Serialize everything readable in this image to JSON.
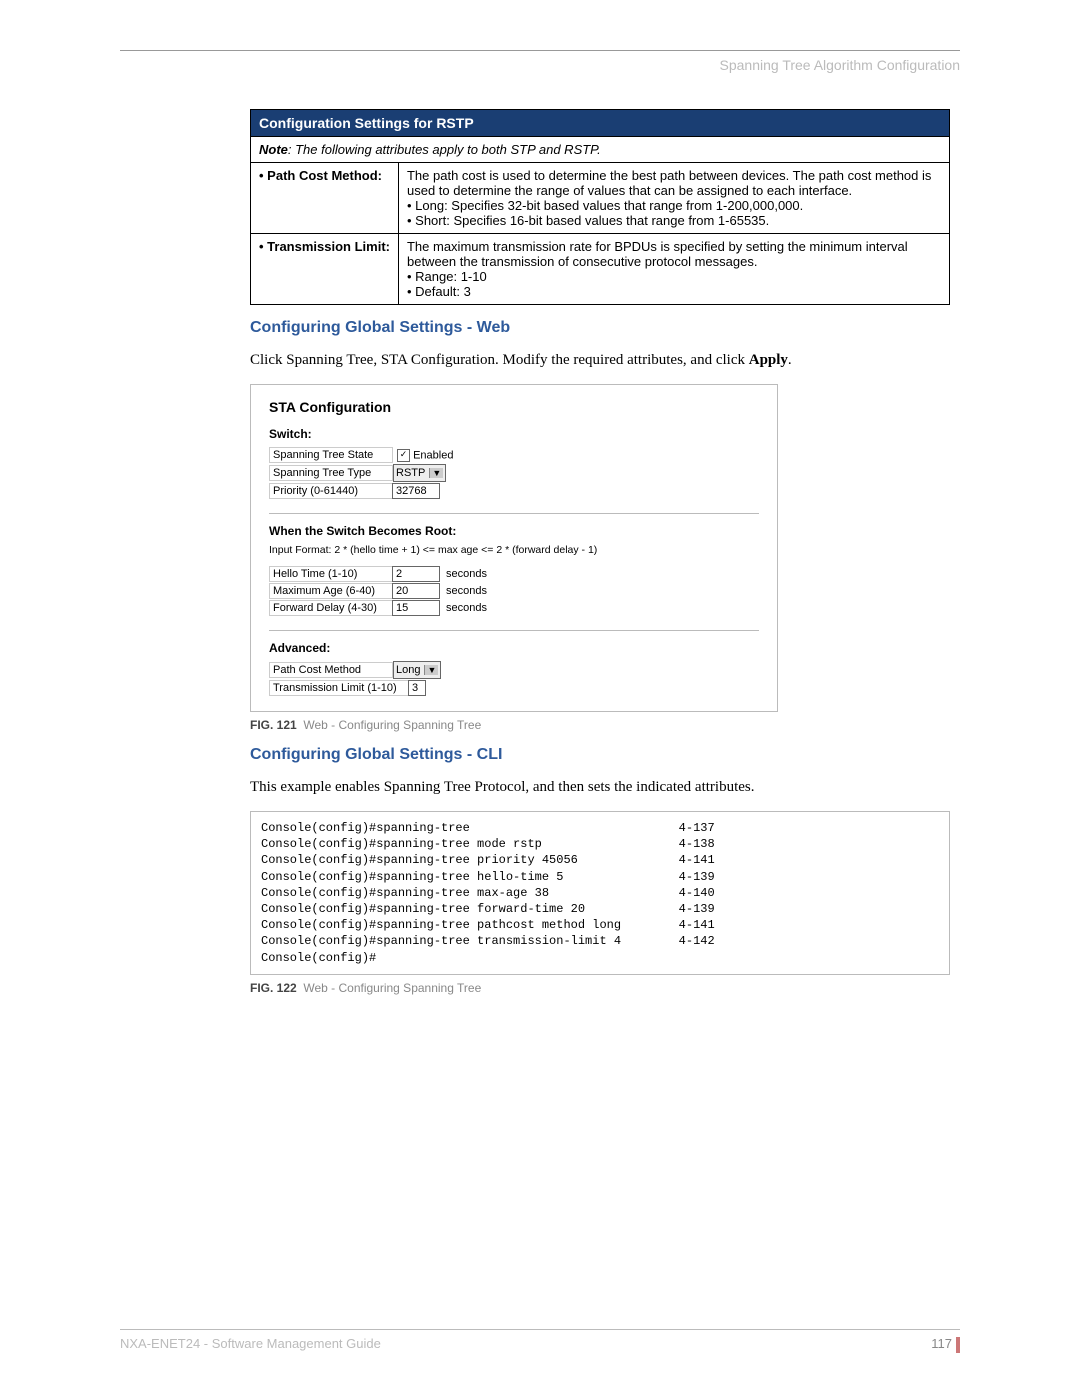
{
  "header": {
    "breadcrumb": "Spanning Tree Algorithm Configuration"
  },
  "table": {
    "title": "Configuration Settings for RSTP",
    "note_label": "Note",
    "note_body": ": The following attributes apply to both STP and RSTP.",
    "rows": [
      {
        "name": "Path Cost Method:",
        "desc": "The path cost is used to determine the best path between devices. The path cost method is used to determine the range of values that can be assigned to each interface.",
        "bullets": [
          "Long: Specifies 32-bit based values that range from 1-200,000,000.",
          "Short: Specifies 16-bit based values that range from 1-65535."
        ]
      },
      {
        "name": "Transmission Limit:",
        "desc": "The maximum transmission rate for BPDUs is specified by setting the minimum interval between the transmission of consecutive protocol messages.",
        "bullets": [
          "Range: 1-10",
          "Default: 3"
        ]
      }
    ]
  },
  "web": {
    "heading": "Configuring Global Settings - Web",
    "intro_pre": "Click Spanning Tree, STA Configuration. Modify the required attributes, and click ",
    "intro_bold": "Apply",
    "intro_post": ".",
    "panel": {
      "title": "STA Configuration",
      "switch_label": "Switch:",
      "state_label": "Spanning Tree State",
      "state_value": "Enabled",
      "type_label": "Spanning Tree Type",
      "type_value": "RSTP",
      "priority_label": "Priority (0-61440)",
      "priority_value": "32768",
      "root_label": "When the Switch Becomes Root:",
      "formula": "Input Format: 2 * (hello time + 1) <= max age <= 2 * (forward delay - 1)",
      "hello_label": "Hello Time (1-10)",
      "hello_value": "2",
      "maxage_label": "Maximum Age (6-40)",
      "maxage_value": "20",
      "fwd_label": "Forward Delay (4-30)",
      "fwd_value": "15",
      "seconds": "seconds",
      "advanced_label": "Advanced:",
      "pcm_label": "Path Cost Method",
      "pcm_value": "Long",
      "tl_label": "Transmission Limit (1-10)",
      "tl_value": "3"
    },
    "caption_num": "FIG. 121",
    "caption_text": "Web - Configuring Spanning Tree"
  },
  "cli": {
    "heading": "Configuring Global Settings - CLI",
    "intro": "This example enables Spanning Tree Protocol, and then sets the indicated attributes.",
    "lines": [
      {
        "cmd": "Console(config)#spanning-tree",
        "ref": "4-137"
      },
      {
        "cmd": "Console(config)#spanning-tree mode rstp",
        "ref": "4-138"
      },
      {
        "cmd": "Console(config)#spanning-tree priority 45056",
        "ref": "4-141"
      },
      {
        "cmd": "Console(config)#spanning-tree hello-time 5",
        "ref": "4-139"
      },
      {
        "cmd": "Console(config)#spanning-tree max-age 38",
        "ref": "4-140"
      },
      {
        "cmd": "Console(config)#spanning-tree forward-time 20",
        "ref": "4-139"
      },
      {
        "cmd": "Console(config)#spanning-tree pathcost method long",
        "ref": "4-141"
      },
      {
        "cmd": "Console(config)#spanning-tree transmission-limit 4",
        "ref": "4-142"
      },
      {
        "cmd": "Console(config)#",
        "ref": ""
      }
    ],
    "caption_num": "FIG. 122",
    "caption_text": "Web - Configuring Spanning Tree"
  },
  "footer": {
    "doc": "NXA-ENET24 - Software Management Guide",
    "page": "117"
  }
}
